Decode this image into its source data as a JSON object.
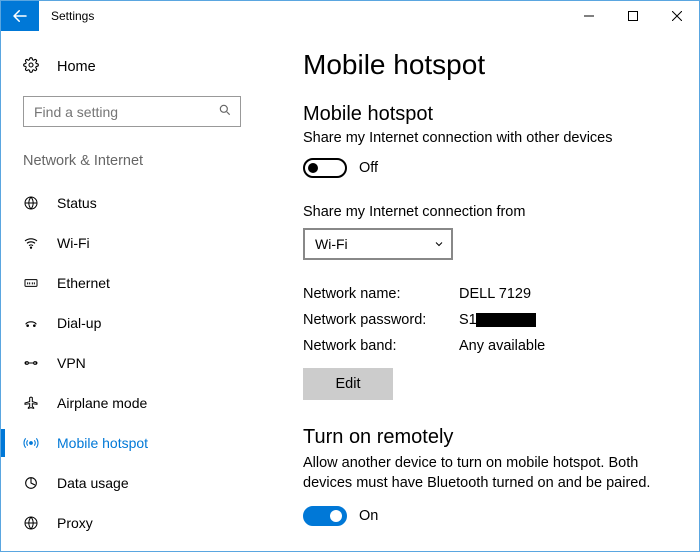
{
  "window": {
    "title": "Settings"
  },
  "sidebar": {
    "home": "Home",
    "search_placeholder": "Find a setting",
    "group": "Network & Internet",
    "items": [
      {
        "label": "Status"
      },
      {
        "label": "Wi-Fi"
      },
      {
        "label": "Ethernet"
      },
      {
        "label": "Dial-up"
      },
      {
        "label": "VPN"
      },
      {
        "label": "Airplane mode"
      },
      {
        "label": "Mobile hotspot"
      },
      {
        "label": "Data usage"
      },
      {
        "label": "Proxy"
      }
    ]
  },
  "main": {
    "page_title": "Mobile hotspot",
    "section1": {
      "title": "Mobile hotspot",
      "desc": "Share my Internet connection with other devices",
      "toggle_state": "Off"
    },
    "share_from": {
      "label": "Share my Internet connection from",
      "value": "Wi-Fi"
    },
    "network": {
      "name_label": "Network name:",
      "name_value": "DELL 7129",
      "password_label": "Network password:",
      "password_visible_prefix": "S1",
      "band_label": "Network band:",
      "band_value": "Any available",
      "edit_btn": "Edit"
    },
    "remote": {
      "title": "Turn on remotely",
      "desc": "Allow another device to turn on mobile hotspot. Both devices must have Bluetooth turned on and be paired.",
      "toggle_state": "On"
    }
  }
}
